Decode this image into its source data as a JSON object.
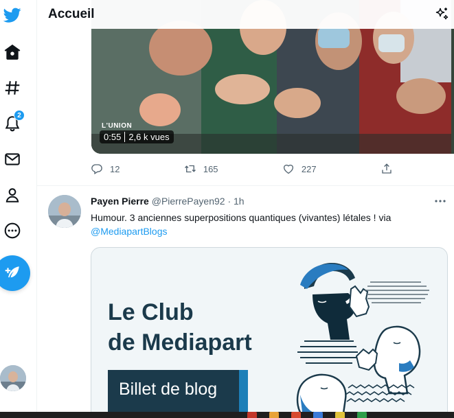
{
  "header": {
    "title": "Accueil",
    "sparkle_icon": "sparkle-icon"
  },
  "nav": {
    "items": [
      {
        "name": "logo",
        "icon": "twitter-bird-icon"
      },
      {
        "name": "home",
        "icon": "home-icon"
      },
      {
        "name": "explore",
        "icon": "hashtag-icon"
      },
      {
        "name": "notifications",
        "icon": "bell-icon",
        "badge": "2"
      },
      {
        "name": "messages",
        "icon": "envelope-icon"
      },
      {
        "name": "profile",
        "icon": "person-icon"
      },
      {
        "name": "more",
        "icon": "more-circle-icon"
      }
    ],
    "compose_icon": "feather-plus-icon"
  },
  "tweet1": {
    "video": {
      "duration": "0:55",
      "views": "2,6 k vues",
      "overlay_text": "L'UNION"
    },
    "replies": "12",
    "retweets": "165",
    "likes": "227"
  },
  "tweet2": {
    "name": "Payen Pierre",
    "handle": "@PierrePayen92",
    "separator": "·",
    "time": "1h",
    "text": "Humour. 3 anciennes superpositions quantiques (vivantes) létales ! via",
    "mention": "@MediapartBlogs",
    "card": {
      "line1": "Le Club",
      "line2": "de Mediapart",
      "button": "Billet de blog"
    }
  },
  "colors": {
    "accent": "#1d9bf0",
    "text": "#0f1419",
    "muted": "#536471",
    "card_navy": "#1b3a4b",
    "card_bg": "#f1f6f8"
  }
}
